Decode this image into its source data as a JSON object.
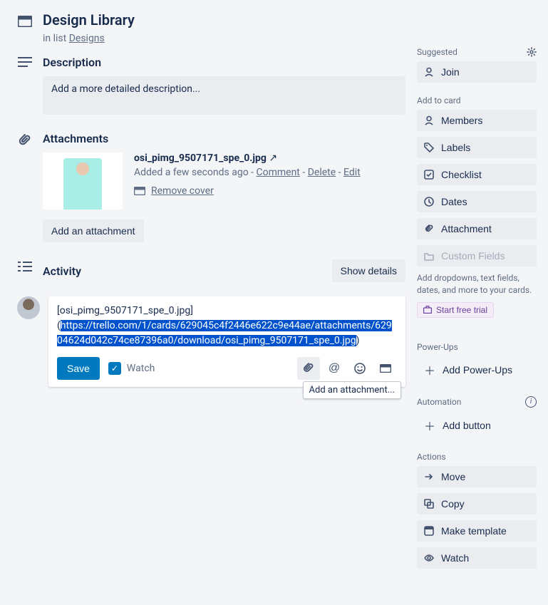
{
  "header": {
    "title": "Design Library",
    "inListPrefix": "in list ",
    "listName": "Designs"
  },
  "description": {
    "heading": "Description",
    "placeholder": "Add a more detailed description..."
  },
  "attachments": {
    "heading": "Attachments",
    "item": {
      "name": "osi_pimg_9507171_spe_0.jpg",
      "addedPrefix": "Added a few seconds ago - ",
      "commentLabel": "Comment",
      "sep": " - ",
      "deleteLabel": "Delete",
      "editLabel": "Edit",
      "removeCoverLabel": "Remove cover"
    },
    "addButton": "Add an attachment"
  },
  "activity": {
    "heading": "Activity",
    "showDetails": "Show details",
    "commentPlain1": "[osi_pimg_9507171_spe_0.jpg]",
    "commentPlain2a": "(",
    "commentSelected": "https://trello.com/1/cards/629045c4f2446e622c9e44ae/attachments/62904624d042c74ce87396a0/download/osi_pimg_9507171_spe_0.jpg",
    "commentPlain2b": ")",
    "saveLabel": "Save",
    "watchLabel": "Watch",
    "tooltip": "Add an attachment..."
  },
  "sidebar": {
    "suggested": {
      "heading": "Suggested",
      "join": "Join"
    },
    "addToCard": {
      "heading": "Add to card",
      "members": "Members",
      "labels": "Labels",
      "checklist": "Checklist",
      "dates": "Dates",
      "attachment": "Attachment",
      "customFields": "Custom Fields"
    },
    "customFieldsNote": "Add dropdowns, text fields, dates, and more to your cards.",
    "trialLabel": "Start free trial",
    "powerUps": {
      "heading": "Power-Ups",
      "add": "Add Power-Ups"
    },
    "automation": {
      "heading": "Automation",
      "add": "Add button"
    },
    "actions": {
      "heading": "Actions",
      "move": "Move",
      "copy": "Copy",
      "template": "Make template",
      "watch": "Watch"
    }
  }
}
